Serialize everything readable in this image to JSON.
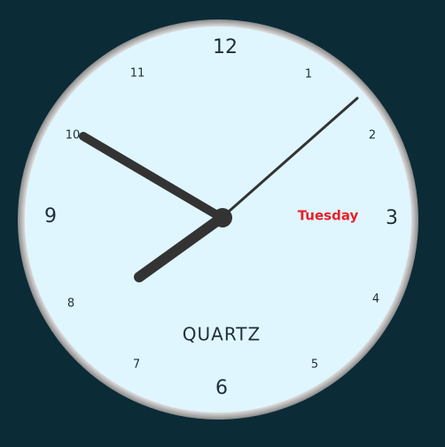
{
  "clock": {
    "brand": "QUARTZ",
    "day": "Tuesday",
    "numerals": {
      "n1": "1",
      "n2": "2",
      "n3": "3",
      "n4": "4",
      "n5": "5",
      "n6": "6",
      "n7": "7",
      "n8": "8",
      "n9": "9",
      "n10": "10",
      "n11": "11",
      "n12": "12"
    },
    "time": {
      "hour": 7,
      "minute": 50,
      "second": 10
    }
  },
  "colors": {
    "background": "#0b2b36",
    "face": "#dff6ff",
    "bezel": "#a9a9a9",
    "hands": "#333333",
    "day_text": "#e8202a",
    "numerals": "#1f2f38"
  }
}
